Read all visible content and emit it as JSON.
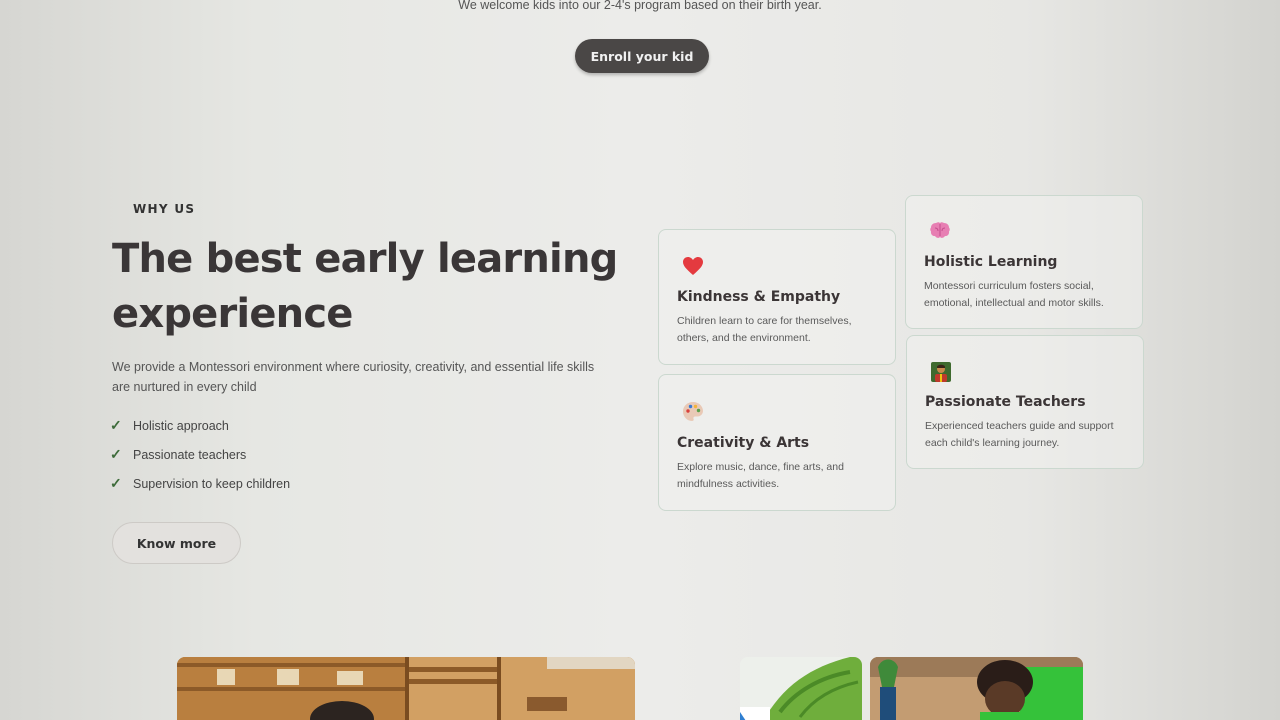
{
  "program": {
    "intro_text": "We welcome kids into our 2-4's program based on their birth year.",
    "enroll_label": "Enroll your kid"
  },
  "why_us": {
    "eyebrow": "WHY US",
    "heading_line1": "The best early learning",
    "heading_line2": "experience",
    "description_line1": "We provide a Montessori environment where curiosity, creativity, and essential life skills",
    "description_line2": "are nurtured in every child",
    "checklist": [
      "Holistic approach",
      "Passionate teachers",
      "Supervision to keep children"
    ],
    "know_more_label": "Know more"
  },
  "features": [
    {
      "icon": "heart-icon",
      "title": "Kindness & Empathy",
      "desc_line1": "Children learn to care for themselves,",
      "desc_line2": "others, and the environment."
    },
    {
      "icon": "palette-icon",
      "title": "Creativity & Arts",
      "desc_line1": "Explore music, dance, fine arts, and",
      "desc_line2": "mindfulness activities."
    },
    {
      "icon": "brain-icon",
      "title": "Holistic Learning",
      "desc_line1": "Montessori curriculum fosters social,",
      "desc_line2": "emotional, intellectual and motor skills."
    },
    {
      "icon": "teacher-icon",
      "title": "Passionate Teachers",
      "desc_line1": "Experienced teachers guide and support",
      "desc_line2": "each child's learning journey."
    }
  ],
  "colors": {
    "button_dark": "#4a4746",
    "check_green": "#3d6b3a",
    "card_border": "#cbd8cf",
    "heading": "#3a3637"
  }
}
